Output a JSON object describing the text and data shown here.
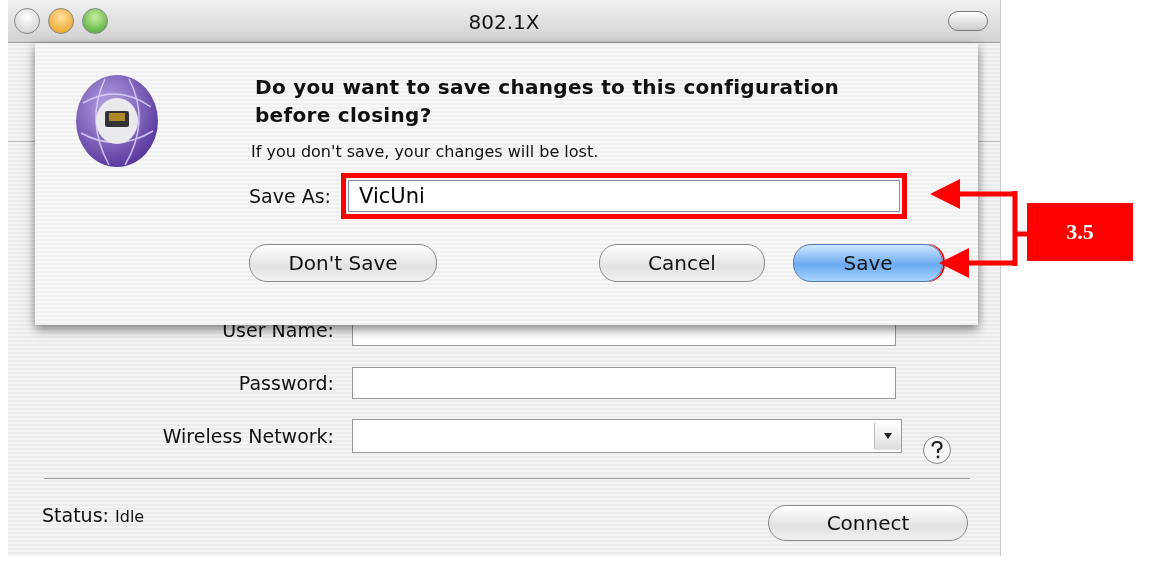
{
  "window": {
    "title": "802.1X"
  },
  "form": {
    "fields": [
      {
        "label": "User Name:",
        "kind": "text"
      },
      {
        "label": "Password:",
        "kind": "text"
      },
      {
        "label": "Wireless Network:",
        "kind": "combo"
      }
    ]
  },
  "status": {
    "label": "Status:",
    "value": "Idle"
  },
  "connect_button": "Connect",
  "sheet": {
    "heading": "Do you want to save changes to this configuration before closing?",
    "message": "If you don't save, your changes will be lost.",
    "save_as": {
      "label": "Save As:",
      "value": "VicUni",
      "highlighted": true
    },
    "buttons": [
      {
        "label": "Don't Save",
        "default": false,
        "highlighted": false
      },
      {
        "label": "Cancel",
        "default": false,
        "highlighted": false
      },
      {
        "label": "Save",
        "default": true,
        "highlighted": true
      }
    ]
  },
  "annotation": {
    "label": "3.5"
  }
}
